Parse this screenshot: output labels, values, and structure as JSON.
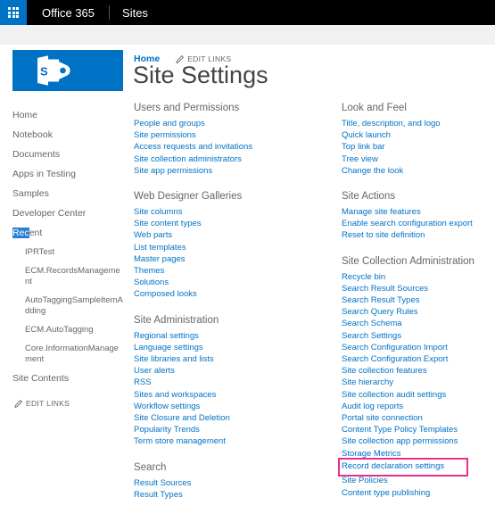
{
  "suite_bar": {
    "waffle_icon": "app-launcher-waffle-icon",
    "brand": "Office 365",
    "app_name": "Sites"
  },
  "site_header": {
    "logo_icon": "sharepoint-logo-icon",
    "breadcrumb_home": "Home",
    "edit_links": "EDIT LINKS",
    "pencil_icon": "pencil-icon",
    "title": "Site Settings"
  },
  "left_nav": {
    "items": [
      {
        "label": "Home",
        "level": "top"
      },
      {
        "label": "Notebook",
        "level": "top"
      },
      {
        "label": "Documents",
        "level": "top"
      },
      {
        "label": "Apps in Testing",
        "level": "top"
      },
      {
        "label": "Samples",
        "level": "top"
      },
      {
        "label": "Developer Center",
        "level": "top"
      },
      {
        "label": "Recent",
        "level": "top",
        "selected_prefix": "Rec",
        "selected_suffix": "ent"
      },
      {
        "label": "IPRTest",
        "level": "child"
      },
      {
        "label": "ECM.RecordsManagement",
        "level": "child"
      },
      {
        "label": "AutoTaggingSampleItemAdding",
        "level": "child"
      },
      {
        "label": "ECM.AutoTagging",
        "level": "child"
      },
      {
        "label": "Core.InformationManagement",
        "level": "child"
      },
      {
        "label": "Site Contents",
        "level": "top"
      }
    ],
    "edit_links": "EDIT LINKS",
    "pencil_icon": "pencil-icon"
  },
  "middle_column": {
    "groups": [
      {
        "title": "Users and Permissions",
        "links": [
          "People and groups",
          "Site permissions",
          "Access requests and invitations",
          "Site collection administrators",
          "Site app permissions"
        ]
      },
      {
        "title": "Web Designer Galleries",
        "links": [
          "Site columns",
          "Site content types",
          "Web parts",
          "List templates",
          "Master pages",
          "Themes",
          "Solutions",
          "Composed looks"
        ]
      },
      {
        "title": "Site Administration",
        "links": [
          "Regional settings",
          "Language settings",
          "Site libraries and lists",
          "User alerts",
          "RSS",
          "Sites and workspaces",
          "Workflow settings",
          "Site Closure and Deletion",
          "Popularity Trends",
          "Term store management"
        ]
      },
      {
        "title": "Search",
        "links": [
          "Result Sources",
          "Result Types"
        ]
      }
    ]
  },
  "right_column": {
    "groups": [
      {
        "title": "Look and Feel",
        "links": [
          "Title, description, and logo",
          "Quick launch",
          "Top link bar",
          "Tree view",
          "Change the look"
        ]
      },
      {
        "title": "Site Actions",
        "links": [
          "Manage site features",
          "Enable search configuration export",
          "Reset to site definition"
        ]
      },
      {
        "title": "Site Collection Administration",
        "links": [
          "Recycle bin",
          "Search Result Sources",
          "Search Result Types",
          "Search Query Rules",
          "Search Schema",
          "Search Settings",
          "Search Configuration Import",
          "Search Configuration Export",
          "Site collection features",
          "Site hierarchy",
          "Site collection audit settings",
          "Audit log reports",
          "Portal site connection",
          "Content Type Policy Templates",
          "Site collection app permissions",
          "Storage Metrics",
          "Record declaration settings",
          "Site Policies",
          "Content type publishing"
        ],
        "highlighted_link": "Record declaration settings"
      }
    ]
  },
  "colors": {
    "suite_bar_bg": "#000000",
    "waffle_bg": "#0072c6",
    "link_blue": "#0072c6",
    "heading_grey": "#666666",
    "highlight_pink": "#e8308a",
    "selection_blue": "#2a7fd4"
  }
}
